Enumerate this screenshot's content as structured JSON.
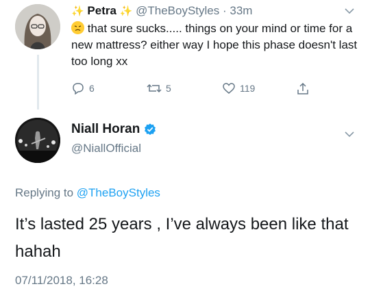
{
  "tweet1": {
    "display_name": "Petra",
    "handle": "@TheBoyStyles",
    "separator": "·",
    "time": "33m",
    "text": "that sure sucks..... things on your mind or time for a new mattress? either way I hope this phase doesn't last too long xx",
    "emoji": "confused-face",
    "reply_count": "6",
    "retweet_count": "5",
    "like_count": "119"
  },
  "tweet2": {
    "display_name": "Niall Horan",
    "handle": "@NiallOfficial",
    "replying_prefix": "Replying to ",
    "replying_handle": "@TheBoyStyles",
    "text": "It’s lasted 25 years , I’ve always been like that hahah",
    "date": "07/11/2018, 16:28"
  },
  "colors": {
    "accent": "#1da1f2",
    "muted": "#657786",
    "text": "#14171a",
    "verified": "#1da1f2"
  }
}
